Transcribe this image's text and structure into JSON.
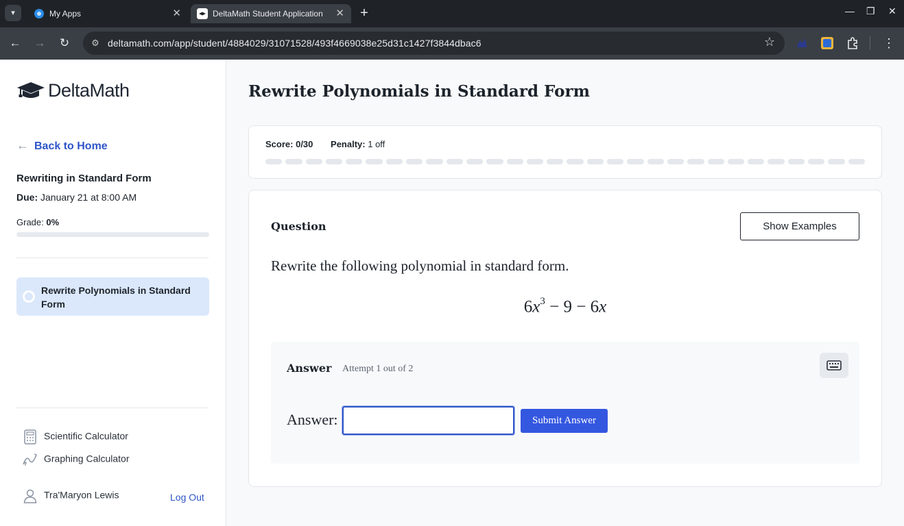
{
  "browser": {
    "tabs": [
      {
        "title": "My Apps",
        "favicon": "my-apps-favicon",
        "active": false
      },
      {
        "title": "DeltaMath Student Application",
        "favicon": "deltamath-favicon",
        "active": true
      }
    ],
    "url": "deltamath.com/app/student/4884029/31071528/493f4669038e25d31c1427f3844dbac6",
    "icons": {
      "tab_menu": "▾",
      "close": "✕",
      "new_tab": "+",
      "back": "←",
      "forward": "→",
      "reload": "↻",
      "site_info": "⚙",
      "star": "☆",
      "kebab": "⋮",
      "minimize": "—",
      "restore": "❐",
      "window_close": "✕"
    }
  },
  "sidebar": {
    "logo_text": "DeltaMath",
    "back_link": "Back to Home",
    "back_arrow": "←",
    "assignment_title": "Rewriting in Standard Form",
    "due_label": "Due:",
    "due_value": "January 21 at 8:00 AM",
    "grade_label": "Grade:",
    "grade_value": "0%",
    "grade_fraction": 0,
    "skill_item": "Rewrite Polynomials in Standard Form",
    "tools": [
      {
        "label": "Scientific Calculator",
        "icon": "calculator-icon"
      },
      {
        "label": "Graphing Calculator",
        "icon": "graph-icon"
      }
    ],
    "user_name": "Tra'Maryon Lewis",
    "logout": "Log Out"
  },
  "main": {
    "page_title": "Rewrite Polynomials in Standard Form",
    "score_label": "Score:",
    "score_value": "0/30",
    "penalty_label": "Penalty:",
    "penalty_value": "1 off",
    "score_segments": 30,
    "question_heading": "Question",
    "show_examples": "Show Examples",
    "prompt": "Rewrite the following polynomial in standard form.",
    "math": {
      "coef1": "6",
      "var1": "x",
      "exp1": "3",
      "rest": " − 9 − 6",
      "var2": "x"
    },
    "answer_heading": "Answer",
    "attempt_text": "Attempt 1 out of 2",
    "answer_label": "Answer:",
    "answer_value": "",
    "submit": "Submit Answer"
  },
  "colors": {
    "accent": "#2f55c8",
    "submit": "#3457e0",
    "skill_highlight": "#dbe8fb",
    "chrome_dark": "#1f2328",
    "chrome_toolbar": "#3a3f45"
  }
}
